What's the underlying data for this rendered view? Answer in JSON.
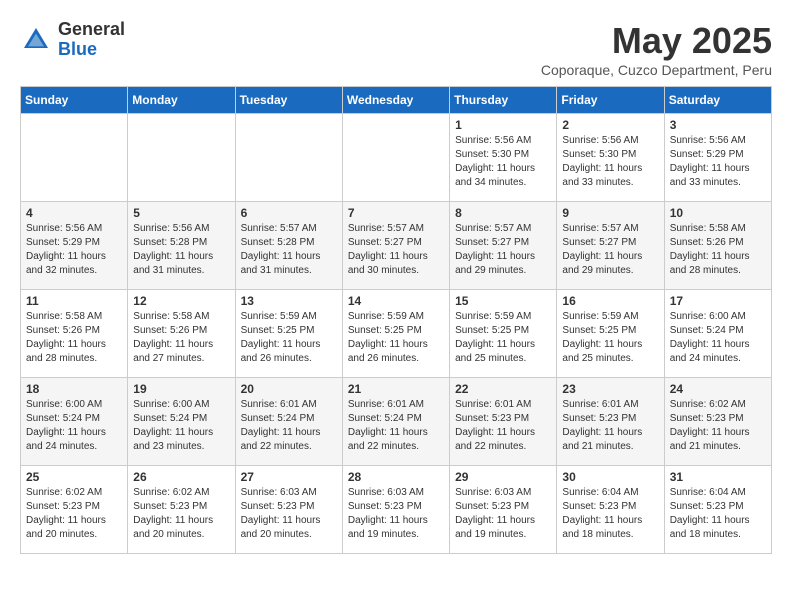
{
  "header": {
    "logo_general": "General",
    "logo_blue": "Blue",
    "month_title": "May 2025",
    "subtitle": "Coporaque, Cuzco Department, Peru"
  },
  "days_of_week": [
    "Sunday",
    "Monday",
    "Tuesday",
    "Wednesday",
    "Thursday",
    "Friday",
    "Saturday"
  ],
  "weeks": [
    [
      {
        "day": "",
        "info": ""
      },
      {
        "day": "",
        "info": ""
      },
      {
        "day": "",
        "info": ""
      },
      {
        "day": "",
        "info": ""
      },
      {
        "day": "1",
        "info": "Sunrise: 5:56 AM\nSunset: 5:30 PM\nDaylight: 11 hours\nand 34 minutes."
      },
      {
        "day": "2",
        "info": "Sunrise: 5:56 AM\nSunset: 5:30 PM\nDaylight: 11 hours\nand 33 minutes."
      },
      {
        "day": "3",
        "info": "Sunrise: 5:56 AM\nSunset: 5:29 PM\nDaylight: 11 hours\nand 33 minutes."
      }
    ],
    [
      {
        "day": "4",
        "info": "Sunrise: 5:56 AM\nSunset: 5:29 PM\nDaylight: 11 hours\nand 32 minutes."
      },
      {
        "day": "5",
        "info": "Sunrise: 5:56 AM\nSunset: 5:28 PM\nDaylight: 11 hours\nand 31 minutes."
      },
      {
        "day": "6",
        "info": "Sunrise: 5:57 AM\nSunset: 5:28 PM\nDaylight: 11 hours\nand 31 minutes."
      },
      {
        "day": "7",
        "info": "Sunrise: 5:57 AM\nSunset: 5:27 PM\nDaylight: 11 hours\nand 30 minutes."
      },
      {
        "day": "8",
        "info": "Sunrise: 5:57 AM\nSunset: 5:27 PM\nDaylight: 11 hours\nand 29 minutes."
      },
      {
        "day": "9",
        "info": "Sunrise: 5:57 AM\nSunset: 5:27 PM\nDaylight: 11 hours\nand 29 minutes."
      },
      {
        "day": "10",
        "info": "Sunrise: 5:58 AM\nSunset: 5:26 PM\nDaylight: 11 hours\nand 28 minutes."
      }
    ],
    [
      {
        "day": "11",
        "info": "Sunrise: 5:58 AM\nSunset: 5:26 PM\nDaylight: 11 hours\nand 28 minutes."
      },
      {
        "day": "12",
        "info": "Sunrise: 5:58 AM\nSunset: 5:26 PM\nDaylight: 11 hours\nand 27 minutes."
      },
      {
        "day": "13",
        "info": "Sunrise: 5:59 AM\nSunset: 5:25 PM\nDaylight: 11 hours\nand 26 minutes."
      },
      {
        "day": "14",
        "info": "Sunrise: 5:59 AM\nSunset: 5:25 PM\nDaylight: 11 hours\nand 26 minutes."
      },
      {
        "day": "15",
        "info": "Sunrise: 5:59 AM\nSunset: 5:25 PM\nDaylight: 11 hours\nand 25 minutes."
      },
      {
        "day": "16",
        "info": "Sunrise: 5:59 AM\nSunset: 5:25 PM\nDaylight: 11 hours\nand 25 minutes."
      },
      {
        "day": "17",
        "info": "Sunrise: 6:00 AM\nSunset: 5:24 PM\nDaylight: 11 hours\nand 24 minutes."
      }
    ],
    [
      {
        "day": "18",
        "info": "Sunrise: 6:00 AM\nSunset: 5:24 PM\nDaylight: 11 hours\nand 24 minutes."
      },
      {
        "day": "19",
        "info": "Sunrise: 6:00 AM\nSunset: 5:24 PM\nDaylight: 11 hours\nand 23 minutes."
      },
      {
        "day": "20",
        "info": "Sunrise: 6:01 AM\nSunset: 5:24 PM\nDaylight: 11 hours\nand 22 minutes."
      },
      {
        "day": "21",
        "info": "Sunrise: 6:01 AM\nSunset: 5:24 PM\nDaylight: 11 hours\nand 22 minutes."
      },
      {
        "day": "22",
        "info": "Sunrise: 6:01 AM\nSunset: 5:23 PM\nDaylight: 11 hours\nand 22 minutes."
      },
      {
        "day": "23",
        "info": "Sunrise: 6:01 AM\nSunset: 5:23 PM\nDaylight: 11 hours\nand 21 minutes."
      },
      {
        "day": "24",
        "info": "Sunrise: 6:02 AM\nSunset: 5:23 PM\nDaylight: 11 hours\nand 21 minutes."
      }
    ],
    [
      {
        "day": "25",
        "info": "Sunrise: 6:02 AM\nSunset: 5:23 PM\nDaylight: 11 hours\nand 20 minutes."
      },
      {
        "day": "26",
        "info": "Sunrise: 6:02 AM\nSunset: 5:23 PM\nDaylight: 11 hours\nand 20 minutes."
      },
      {
        "day": "27",
        "info": "Sunrise: 6:03 AM\nSunset: 5:23 PM\nDaylight: 11 hours\nand 20 minutes."
      },
      {
        "day": "28",
        "info": "Sunrise: 6:03 AM\nSunset: 5:23 PM\nDaylight: 11 hours\nand 19 minutes."
      },
      {
        "day": "29",
        "info": "Sunrise: 6:03 AM\nSunset: 5:23 PM\nDaylight: 11 hours\nand 19 minutes."
      },
      {
        "day": "30",
        "info": "Sunrise: 6:04 AM\nSunset: 5:23 PM\nDaylight: 11 hours\nand 18 minutes."
      },
      {
        "day": "31",
        "info": "Sunrise: 6:04 AM\nSunset: 5:23 PM\nDaylight: 11 hours\nand 18 minutes."
      }
    ]
  ]
}
